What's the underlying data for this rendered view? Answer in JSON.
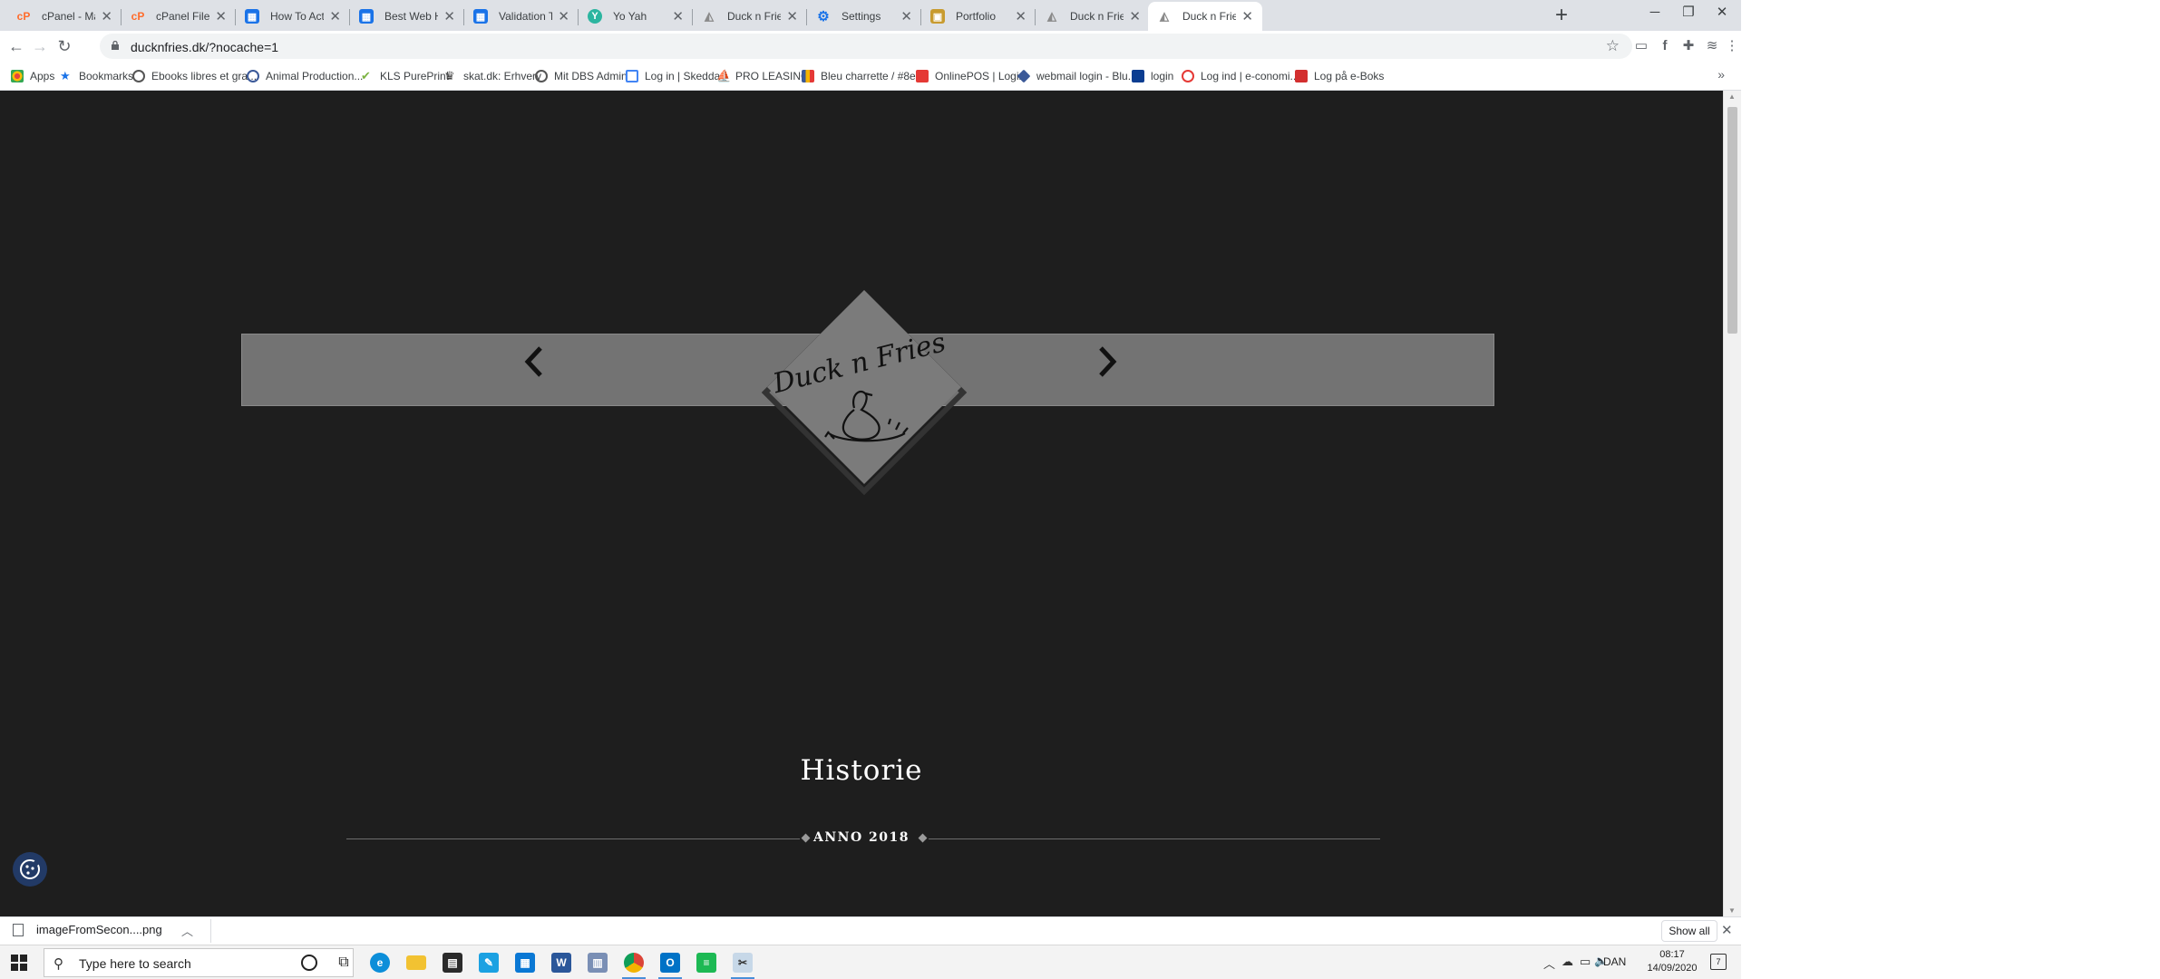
{
  "browser": {
    "tabs": [
      {
        "title": "cPanel - Main",
        "icon": "cpanel-icon",
        "color": "#ff6c2c"
      },
      {
        "title": "cPanel File Mana",
        "icon": "cpanel-icon",
        "color": "#ff6c2c"
      },
      {
        "title": "How To Activate",
        "icon": "sheets-icon",
        "color": "#1a73e8"
      },
      {
        "title": "Best Web Hostin",
        "icon": "sheets-icon",
        "color": "#1a73e8"
      },
      {
        "title": "Validation Token",
        "icon": "sheets-icon",
        "color": "#1a73e8"
      },
      {
        "title": "Yo Yah",
        "icon": "yoast-icon",
        "color": "#2cb5a0"
      },
      {
        "title": "Duck n Fries",
        "icon": "duck-icon",
        "color": "#9e9e9e"
      },
      {
        "title": "Settings",
        "icon": "gear-icon",
        "color": "#1a73e8"
      },
      {
        "title": "Portfolio",
        "icon": "portfolio-icon",
        "color": "#c89b2f"
      },
      {
        "title": "Duck n Fries",
        "icon": "duck-icon",
        "color": "#9e9e9e"
      },
      {
        "title": "Duck n Fries",
        "icon": "duck-icon",
        "color": "#9e9e9e",
        "active": true
      }
    ],
    "url": "ducknfries.dk/?nocache=1",
    "bookmarks": [
      {
        "label": "Apps",
        "color": "#e8453c"
      },
      {
        "label": "Bookmarks",
        "color": "#1a73e8"
      },
      {
        "label": "Ebooks libres et gra...",
        "color": "#555555"
      },
      {
        "label": "Animal Production...",
        "color": "#3b5998"
      },
      {
        "label": "KLS PurePrint",
        "color": "#7cb342"
      },
      {
        "label": "skat.dk: Erhverv",
        "color": "#444444"
      },
      {
        "label": "Mit DBS Admin",
        "color": "#555555"
      },
      {
        "label": "Log in | Skedda",
        "color": "#4285f4"
      },
      {
        "label": "PRO LEASING",
        "color": "#222222"
      },
      {
        "label": "Bleu charrette / #8e...",
        "color": "#f4b400"
      },
      {
        "label": "OnlinePOS | Login",
        "color": "#e53935"
      },
      {
        "label": "webmail login - Blu...",
        "color": "#3b5998"
      },
      {
        "label": "login",
        "color": "#0b3d91"
      },
      {
        "label": "Log ind | e-conomi...",
        "color": "#e53935"
      },
      {
        "label": "Log på e-Boks",
        "color": "#d32f2f"
      }
    ]
  },
  "page": {
    "logo_text": "Duck n Fries",
    "section_title": "Historie",
    "section_subtitle": "ANNO 2018",
    "background": "#1e1e1e",
    "band_color": "#737373"
  },
  "download_bar": {
    "filename": "imageFromSecon....png",
    "show_all": "Show all"
  },
  "taskbar": {
    "search_placeholder": "Type here to search",
    "language": "DAN",
    "time": "08:17",
    "date": "14/09/2020",
    "notification_count": "7"
  }
}
